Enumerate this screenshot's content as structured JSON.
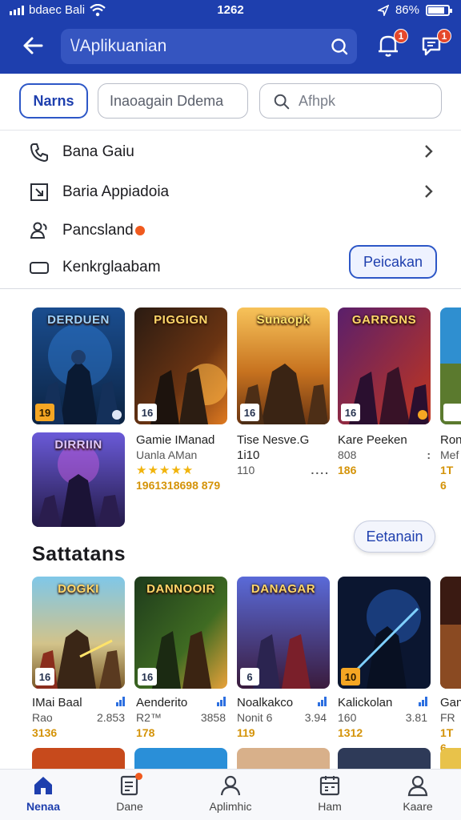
{
  "status": {
    "carrier": "bdaec Bali",
    "time": "1262",
    "battery": "86%"
  },
  "header": {
    "search_text": "\\/Aplikuanian",
    "notif_badge": "1",
    "msg_badge": "1"
  },
  "filters": {
    "primary": "Narns",
    "input_placeholder": "Inaoagain Ddema",
    "search_placeholder": "Afhpk"
  },
  "menu": [
    {
      "label": "Bana Gaiu"
    },
    {
      "label": "Baria Appiadoia"
    },
    {
      "label": "Pancsland"
    },
    {
      "label": "Kenkrglaabam"
    }
  ],
  "menu_button": "Peicakan",
  "tiles_top": [
    {
      "title": "DERDUEN",
      "age": "19"
    },
    {
      "title": "PIGGIGN",
      "age": "16"
    },
    {
      "title": "Sunaopk",
      "age": "16"
    },
    {
      "title": "GARRGNS",
      "age": "16"
    },
    {
      "title": "",
      "age": ""
    }
  ],
  "second_row": [
    {
      "title": "DIRRIIN"
    },
    {
      "title": "Gamie IManad",
      "sub": "Uanla AMan",
      "stars": "★★★★★",
      "num": "1961318698 879"
    },
    {
      "title": "Tise Nesve.G 1i10",
      "sub": "110",
      "dots": "....",
      "num": ""
    },
    {
      "title": "Kare Peeken",
      "sub": "808",
      "dots": ":",
      "num": "186"
    },
    {
      "title": "Ron",
      "sub": "Mef",
      "num": "1T 6"
    }
  ],
  "more_button": "Eetanain",
  "section_title": "Sattatans",
  "tiles_bottom": [
    {
      "title": "DOGKI",
      "age": "16"
    },
    {
      "title": "DANNOOIR",
      "age": "16"
    },
    {
      "title": "DANAGAR",
      "age": "6"
    },
    {
      "title": "",
      "age": "10"
    },
    {
      "title": "",
      "age": ""
    }
  ],
  "bottom_info": [
    {
      "title": "IMai Baal",
      "rt": "",
      "sub": "Rao",
      "sub_rt": "2.853",
      "num": "3136"
    },
    {
      "title": "Aenderito",
      "rt": "",
      "sub": "R2™",
      "sub_rt": "3858",
      "num": "178"
    },
    {
      "title": "Noalkakco",
      "rt": "",
      "sub": "Nonit 6",
      "sub_rt": "3.94",
      "num": "119"
    },
    {
      "title": "Kalickolan",
      "rt": "",
      "sub": "160",
      "sub_rt": "3.81",
      "num": "1312"
    },
    {
      "title": "Gan",
      "rt": "",
      "sub": "FR",
      "sub_rt": "",
      "num": "1T 6"
    }
  ],
  "nav": [
    {
      "label": "Nenaa",
      "icon": "home-icon",
      "active": true
    },
    {
      "label": "Dane",
      "icon": "document-icon"
    },
    {
      "label": "Aplimhic",
      "icon": "person-icon"
    },
    {
      "label": "Ham",
      "icon": "calendar-icon"
    },
    {
      "label": "Kaare",
      "icon": "profile-icon"
    }
  ],
  "colors": {
    "brand": "#1e3fae",
    "accent": "#2d57c7",
    "badge": "#e5482c",
    "rating": "#f1b40d"
  }
}
